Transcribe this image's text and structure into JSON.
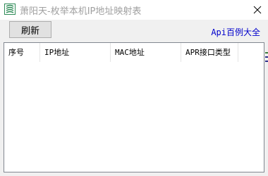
{
  "window": {
    "title": "萧阳天-枚举本机IP地址映射表",
    "icon": "app-logo-icon",
    "close_icon": "close-icon"
  },
  "toolbar": {
    "refresh_label": "刷新",
    "api_link_label": "Api百例大全"
  },
  "table": {
    "columns": [
      {
        "label": "序号"
      },
      {
        "label": "IP地址"
      },
      {
        "label": "MAC地址"
      },
      {
        "label": "APR接口类型"
      }
    ],
    "rows": []
  },
  "colors": {
    "title_text": "#a0a0a0",
    "link": "#0000cc",
    "icon_green": "#2e8b57"
  }
}
